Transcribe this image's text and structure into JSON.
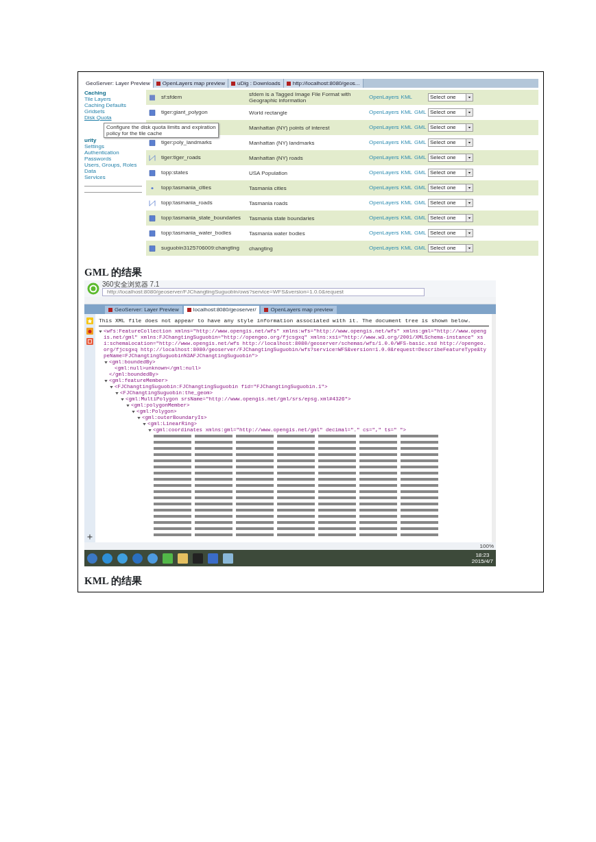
{
  "document": {
    "figure_1": {
      "tabs": [
        {
          "label": "GeoServer: Layer Preview",
          "selected": true
        },
        {
          "label": "OpenLayers map preview",
          "selected": false
        },
        {
          "label": "uDig : Downloads",
          "selected": false
        },
        {
          "label": "http://localhost:8080/geos...",
          "selected": false
        }
      ],
      "sidebar": {
        "sections": [
          {
            "title": "Caching",
            "items": [
              "Tile Layers",
              "Caching Defaults",
              "Gridsets",
              "Disk Quota"
            ]
          },
          {
            "title": "urity",
            "items": [
              "Settings",
              "Authentication",
              "Passwords",
              "Users, Groups, Roles",
              "Data",
              "Services"
            ]
          }
        ]
      },
      "tooltip": "Configure the disk quota limits and expiration policy for the tile cache",
      "layers": [
        {
          "kind": "raster",
          "name": "sf:sfdem",
          "title": "sfdem is a Tagged Image File Format with Geographic information",
          "links": [
            "OpenLayers",
            "KML"
          ],
          "select": "Select one"
        },
        {
          "kind": "polygon",
          "name": "tiger:giant_polygon",
          "title": "World rectangle",
          "links": [
            "OpenLayers",
            "KML",
            "GML"
          ],
          "select": "Select one"
        },
        {
          "title": "Manhattan (NY) points of interest",
          "links": [
            "OpenLayers",
            "KML",
            "GML"
          ],
          "select": "Select one"
        },
        {
          "kind": "polygon",
          "name": "tiger:poly_landmarks",
          "title": "Manhattan (NY) landmarks",
          "links": [
            "OpenLayers",
            "KML",
            "GML"
          ],
          "select": "Select one"
        },
        {
          "kind": "line",
          "name": "tiger:tiger_roads",
          "title": "Manhattan (NY) roads",
          "links": [
            "OpenLayers",
            "KML",
            "GML"
          ],
          "select": "Select one"
        },
        {
          "kind": "polygon",
          "name": "topp:states",
          "title": "USA Population",
          "links": [
            "OpenLayers",
            "KML",
            "GML"
          ],
          "select": "Select one"
        },
        {
          "kind": "point",
          "name": "topp:tasmania_cities",
          "title": "Tasmania cities",
          "links": [
            "OpenLayers",
            "KML",
            "GML"
          ],
          "select": "Select one"
        },
        {
          "kind": "line",
          "name": "topp:tasmania_roads",
          "title": "Tasmania roads",
          "links": [
            "OpenLayers",
            "KML",
            "GML"
          ],
          "select": "Select one"
        },
        {
          "kind": "polygon",
          "name": "topp:tasmania_state_boundaries",
          "title": "Tasmania state boundaries",
          "links": [
            "OpenLayers",
            "KML",
            "GML"
          ],
          "select": "Select one"
        },
        {
          "kind": "polygon",
          "name": "topp:tasmania_water_bodies",
          "title": "Tasmania water bodies",
          "links": [
            "OpenLayers",
            "KML",
            "GML"
          ],
          "select": "Select one"
        },
        {
          "kind": "polygon",
          "name": "suguobin3125706009:changting",
          "title": "changting",
          "links": [
            "OpenLayers",
            "KML",
            "GML"
          ],
          "select": "Select one"
        }
      ]
    },
    "caption_1": "GML 的结果",
    "figure_2": {
      "window": {
        "title": "360安全浏览器 7.1"
      },
      "address": "http://localhost:8080/geoserver/FJChangtingSuguobin/ows?service=WFS&version=1.0.0&request",
      "tabs": [
        {
          "label": "GeoServer: Layer Preview",
          "selected": false
        },
        {
          "label": "localhost:8080/geoserver/",
          "selected": true
        },
        {
          "label": "OpenLayers map preview",
          "selected": false
        }
      ],
      "xml_note": "This XML file does not appear to have any style information associated with it. The document tree is shown below.",
      "xml_tree": [
        {
          "open": "<wfs:FeatureCollection xmlns=\"http://www.opengis.net/wfs\" xmlns:wfs=\"http://www.opengis.net/wfs\" xmlns:gml=\"http://www.opengis.net/gml\" xmlns:FJChangtingSuguobin=\"http://opengeo.org/fjcsgxq\" xmlns:xsi=\"http://www.w3.org/2001/XMLSchema-instance\" xsi:schemaLocation=\"http://www.opengis.net/wfs http://localhost:8080/geoserver/schemas/wfs/1.0.0/WFS-basic.xsd http://opengeo.org/fjcsgxq http://localhost:8080/geoserver/FJChangtingSuguobin/wfs?service=WFS&version=1.0.0&request=DescribeFeatureType&typeName=FJChangtingSuguobin%3AFJChangtingSuguobin\">",
          "expanded": true,
          "children": [
            {
              "open": "<gml:boundedBy>",
              "expanded": true,
              "children": [
                {
                  "open": "<gml:null>unknown</gml:null>"
                }
              ],
              "close": "</gml:boundedBy>"
            },
            {
              "open": "<gml:featureMember>",
              "expanded": true,
              "children": [
                {
                  "open": "<FJChangtingSuguobin:FJChangtingSuguobin fid=\"FJChangtingSuguobin.1\">",
                  "expanded": true,
                  "children": [
                    {
                      "open": "<FJChangtingSuguobin:the_geom>",
                      "expanded": true,
                      "children": [
                        {
                          "open": "<gml:MultiPolygon srsName=\"http://www.opengis.net/gml/srs/epsg.xml#4326\">",
                          "expanded": true,
                          "children": [
                            {
                              "open": "<gml:polygonMember>",
                              "expanded": true,
                              "children": [
                                {
                                  "open": "<gml:Polygon>",
                                  "expanded": true,
                                  "children": [
                                    {
                                      "open": "<gml:outerBoundaryIs>",
                                      "expanded": true,
                                      "children": [
                                        {
                                          "open": "<gml:LinearRing>",
                                          "expanded": true,
                                          "children": [
                                            {
                                              "open": "<gml:coordinates xmlns:gml=\"http://www.opengis.net/gml\" decimal=\".\" cs=\",\" ts=\" \">",
                                              "expanded": true
                                            }
                                          ]
                                        }
                                      ]
                                    }
                                  ]
                                }
                              ]
                            }
                          ]
                        }
                      ]
                    }
                  ]
                }
              ]
            }
          ]
        }
      ],
      "status_bar": {
        "zoom": "100%"
      },
      "taskbar": {
        "time": "18:23",
        "date": "2015/4/7"
      }
    },
    "caption_2": "KML 的结果"
  }
}
